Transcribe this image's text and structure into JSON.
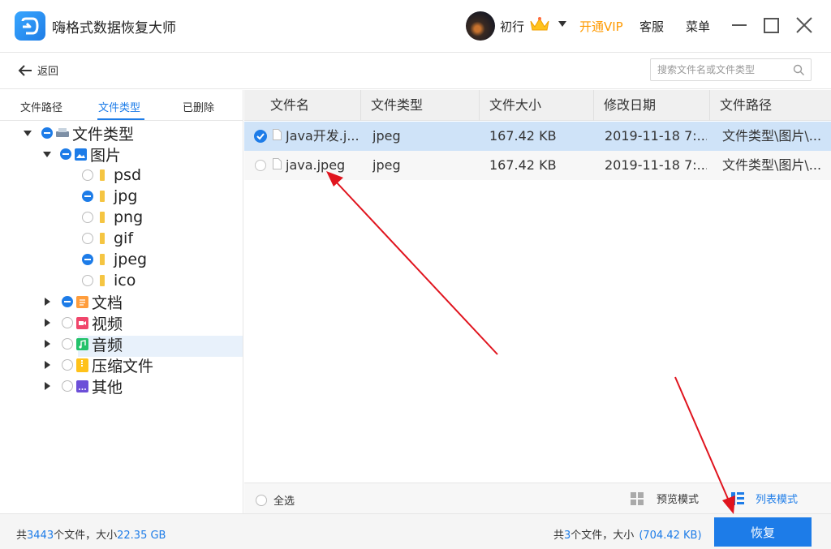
{
  "app": {
    "title": "嗨格式数据恢复大师",
    "user": "初行",
    "vip_link": "开通VIP",
    "service": "客服",
    "menu": "菜单"
  },
  "toolbar": {
    "back_label": "返回",
    "search_placeholder": "搜索文件名或文件类型"
  },
  "sidebar": {
    "tabs": [
      {
        "label": "文件路径",
        "active": false
      },
      {
        "label": "文件类型",
        "active": true
      },
      {
        "label": "已删除",
        "active": false
      }
    ],
    "tree": {
      "root": "文件类型",
      "images": "图片",
      "image_types": [
        "psd",
        "jpg",
        "png",
        "gif",
        "jpeg",
        "ico"
      ],
      "documents": "文档",
      "videos": "视频",
      "audio": "音频",
      "archives": "压缩文件",
      "other": "其他"
    }
  },
  "table": {
    "columns": [
      "文件名",
      "文件类型",
      "文件大小",
      "修改日期",
      "文件路径"
    ],
    "rows": [
      {
        "name": "Java开发.j...",
        "type": "jpeg",
        "size": "167.42 KB",
        "date": "2019-11-18 7:...",
        "path": "文件类型\\图片\\...",
        "checked": true
      },
      {
        "name": "java.jpeg",
        "type": "jpeg",
        "size": "167.42 KB",
        "date": "2019-11-18 7:...",
        "path": "文件类型\\图片\\...",
        "checked": false
      }
    ]
  },
  "bottom": {
    "select_all": "全选",
    "preview_mode": "预览模式",
    "list_mode": "列表模式"
  },
  "status": {
    "total_prefix": "共",
    "total_count": "3443",
    "total_mid": "个文件，大小",
    "total_size": "22.35 GB",
    "sel_prefix": "共",
    "sel_count": "3",
    "sel_mid": "个文件，大小",
    "sel_size": "(704.42 KB)",
    "recover_label": "恢复"
  },
  "colors": {
    "accent": "#1d7ce8",
    "vip": "#ff9a00",
    "annotation": "#e0141e"
  }
}
